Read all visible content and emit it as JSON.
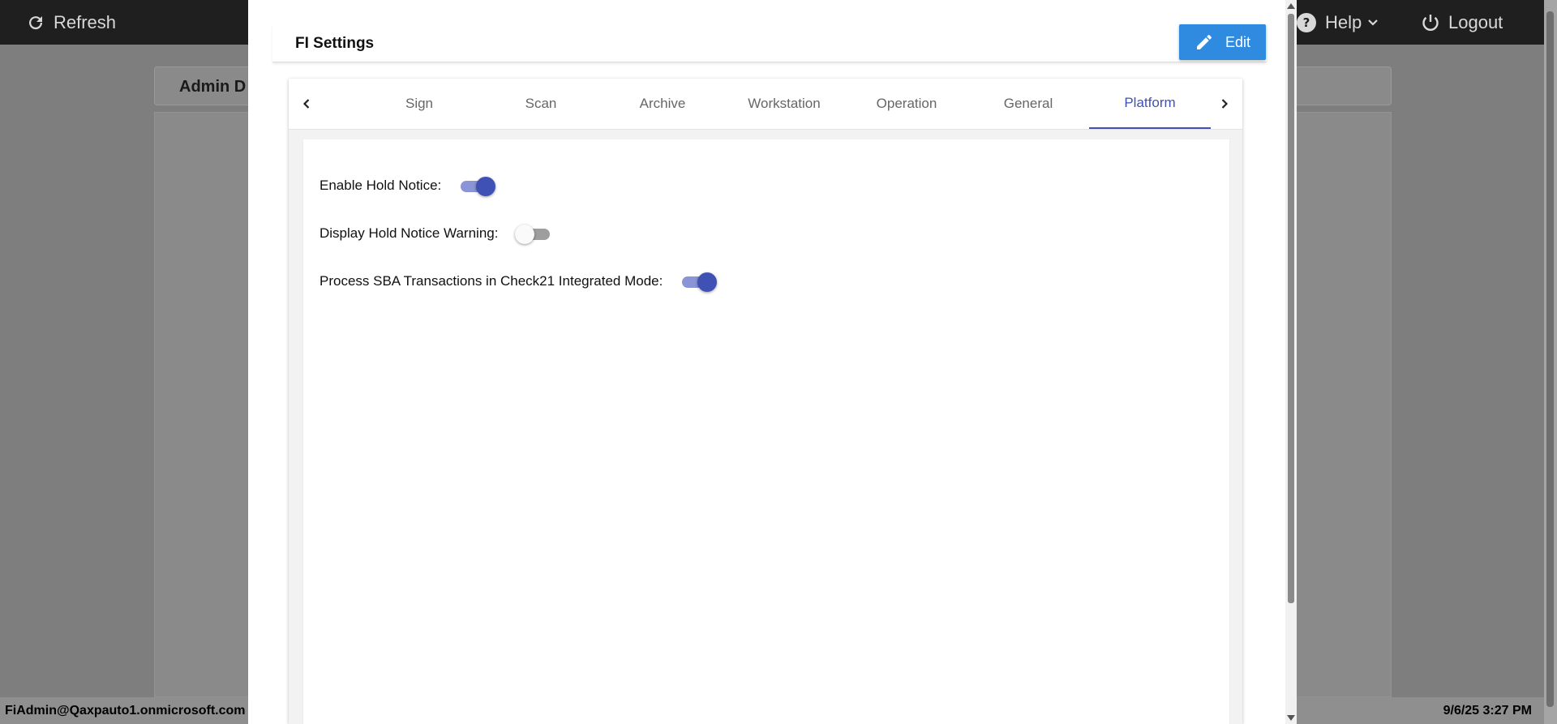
{
  "topbar": {
    "refresh_label": "Refresh",
    "help_label": "Help",
    "logout_label": "Logout"
  },
  "background": {
    "card_title": "Admin D"
  },
  "status": {
    "user": "FiAdmin@Qaxpauto1.onmicrosoft.com",
    "datetime": "9/6/25 3:27 PM"
  },
  "modal": {
    "title": "FI Settings",
    "edit_label": "Edit",
    "tabs": [
      {
        "label": "Sign",
        "active": false
      },
      {
        "label": "Scan",
        "active": false
      },
      {
        "label": "Archive",
        "active": false
      },
      {
        "label": "Workstation",
        "active": false
      },
      {
        "label": "Operation",
        "active": false
      },
      {
        "label": "General",
        "active": false
      },
      {
        "label": "Platform",
        "active": true
      }
    ],
    "settings": [
      {
        "label": "Enable Hold Notice:",
        "enabled": true
      },
      {
        "label": "Display Hold Notice Warning:",
        "enabled": false
      },
      {
        "label": "Process SBA Transactions in Check21 Integrated Mode:",
        "enabled": true
      }
    ]
  },
  "colors": {
    "accent": "#3f51b5",
    "edit_button": "#2f8bdf",
    "topbar": "#1f1f1f"
  },
  "icons": {
    "refresh": "refresh-icon",
    "help": "help-circle-icon",
    "logout": "power-icon",
    "edit": "pencil-icon"
  }
}
